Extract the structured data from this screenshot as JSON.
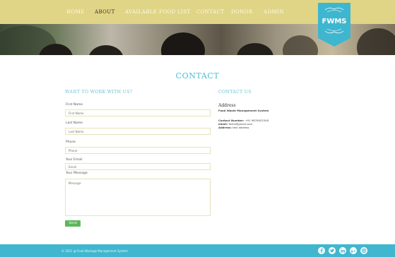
{
  "nav": {
    "items": [
      {
        "label": "HOME",
        "active": false
      },
      {
        "label": "ABOUT",
        "active": true
      },
      {
        "label": "AVAILABLE FOOD LIST",
        "active": false
      },
      {
        "label": "CONTACT",
        "active": false
      },
      {
        "label": "DONOR",
        "active": false
      },
      {
        "label": "ADMIN",
        "active": false
      }
    ]
  },
  "logo": {
    "text": "FWMS",
    "color": "#3fb6cf"
  },
  "page_title": "CONTACT",
  "form": {
    "heading": "WANT TO WORK WITH US?",
    "first_name": {
      "label": "First Name",
      "placeholder": "First Name"
    },
    "last_name": {
      "label": "Last Name",
      "placeholder": "Last Name"
    },
    "phone": {
      "label": "Phone",
      "placeholder": "Phone"
    },
    "email": {
      "label": "Your Email",
      "placeholder": "Email"
    },
    "message": {
      "label": "Your Message",
      "placeholder": "Message"
    },
    "send_label": "Send"
  },
  "contact": {
    "heading": "CONTACT US",
    "address_title": "Address",
    "org_name": "Food Waste Management System",
    "number_label": "Contact Number:",
    "number_value": "+91 9876452348",
    "email_label": "email:",
    "email_value": "fwms@gmail.com",
    "address_label": "Address:",
    "address_value": "test address"
  },
  "footer": {
    "copyright": "© 2021 @ Food Wastage Management System",
    "social_icons": [
      "facebook-icon",
      "twitter-icon",
      "linkedin-icon",
      "google-plus-icon",
      "instagram-icon"
    ]
  },
  "colors": {
    "nav_bg": "#e0d487",
    "accent": "#46c0d3",
    "footer_bg": "#41b7cf",
    "send_button": "#5cb85c"
  }
}
